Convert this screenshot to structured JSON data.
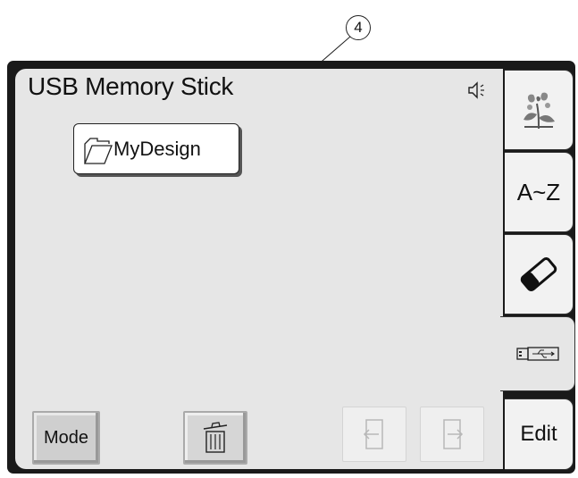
{
  "callout": {
    "number": "4"
  },
  "screen": {
    "title": "USB Memory Stick"
  },
  "folder": {
    "label": "MyDesign"
  },
  "buttons": {
    "mode": "Mode"
  },
  "tabs": {
    "az": "A~Z",
    "edit": "Edit",
    "icons": [
      "embroidery-design-icon",
      "eraser-icon",
      "usb-icon"
    ]
  },
  "icons": [
    "speaker-icon",
    "folder-icon",
    "trash-icon",
    "page-prev-icon",
    "page-next-icon"
  ]
}
